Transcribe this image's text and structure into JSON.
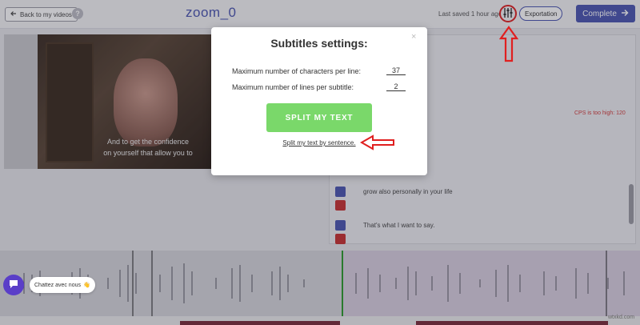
{
  "header": {
    "back_label": "Back to my videos",
    "title": "zoom_0",
    "last_saved": "Last saved 1 hour ago",
    "export_label": "Exportation",
    "complete_label": "Complete"
  },
  "video": {
    "subtitle_lines": [
      "And to get the confidence",
      "on yourself that allow you to"
    ]
  },
  "subtitle_list": {
    "warning": "CPS is too high: 120",
    "rows": [
      {
        "text": "grow also personally in your life"
      },
      {
        "text": "That's what I want to say."
      }
    ]
  },
  "modal": {
    "title": "Subtitles settings:",
    "close_glyph": "×",
    "max_chars_label": "Maximum number of characters per line:",
    "max_chars_value": "37",
    "max_lines_label": "Maximum number of lines per subtitle:",
    "max_lines_value": "2",
    "split_button": "SPLIT MY TEXT",
    "split_by_sentence": "Split my text by sentence."
  },
  "chat": {
    "label": "Chattez avec nous",
    "emoji": "👋"
  },
  "watermark": "wtxkd.com",
  "colors": {
    "accent": "#4a55b0",
    "split_green": "#7ad86a",
    "annotation_red": "#e02020",
    "delete_red": "#c83030",
    "chat_purple": "#5a3ec8"
  }
}
